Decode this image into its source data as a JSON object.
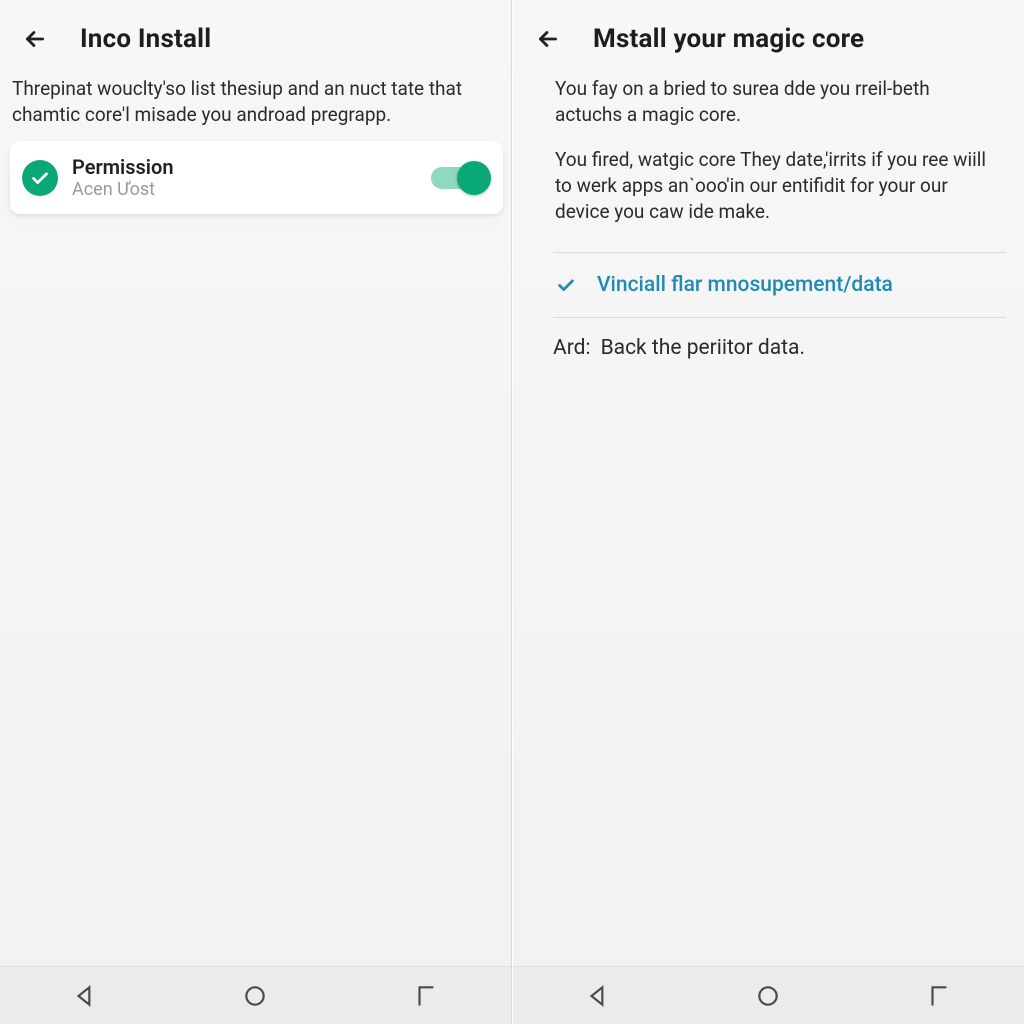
{
  "left": {
    "title": "Inco Install",
    "description": "Threpinat wouclty'so list thesiup and an nuct tate that chamtic core'l misade you androad pregrapp.",
    "permission": {
      "title": "Permission",
      "subtitle": "Acen Ưost",
      "toggle_on": true
    }
  },
  "right": {
    "title": "Mstall your magic core",
    "p1": "You fay on a bried to surea dde you rreil-beth actuchs a magic core.",
    "p2": "You fired, watgic core They date,'irrits if you ree wiill to werk apps anˋooo'in our entifidit for your our device you caw ide make.",
    "link1": "Vinciall flar mnosupement/data",
    "footer_key": "Ard:",
    "footer_val": "Back the periitor data."
  },
  "icons": {
    "back": "back-arrow-icon",
    "check": "check-icon",
    "nav_back": "nav-back-icon",
    "nav_home": "nav-home-icon",
    "nav_recent": "nav-recent-icon"
  }
}
